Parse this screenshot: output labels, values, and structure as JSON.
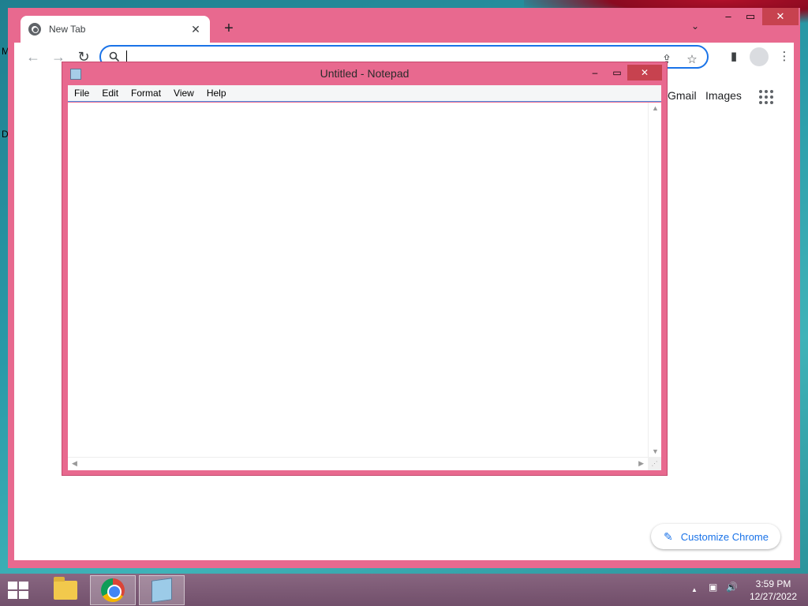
{
  "desktop": {
    "letters": [
      "M",
      "D"
    ]
  },
  "browser": {
    "tab": {
      "title": "New Tab",
      "close": "✕"
    },
    "new_tab": "+",
    "tab_search": "⌄",
    "window_controls": {
      "minimize": "–",
      "maximize": "▭",
      "close": "✕"
    },
    "toolbar": {
      "back": "←",
      "forward": "→",
      "reload": "↻",
      "omnibox_value": "",
      "share": "⇪",
      "bookmark": "☆",
      "side_panel": "▮",
      "menu": "⋮"
    },
    "content": {
      "links": [
        "Gmail",
        "Images"
      ],
      "customize_label": "Customize Chrome",
      "customize_icon": "✎"
    }
  },
  "notepad": {
    "title": "Untitled - Notepad",
    "controls": {
      "minimize": "–",
      "maximize": "▭",
      "close": "✕"
    },
    "menu": [
      "File",
      "Edit",
      "Format",
      "View",
      "Help"
    ],
    "text": "",
    "scroll_up": "▲",
    "scroll_down": "▼",
    "scroll_left": "◀",
    "scroll_right": "▶",
    "grip": "⋰"
  },
  "taskbar": {
    "apps": [
      "file-explorer",
      "google-chrome",
      "notepad"
    ],
    "tray": {
      "chevron": "▲",
      "network": "▣",
      "volume": "🔊"
    },
    "clock": {
      "time": "3:59 PM",
      "date": "12/27/2022"
    }
  }
}
